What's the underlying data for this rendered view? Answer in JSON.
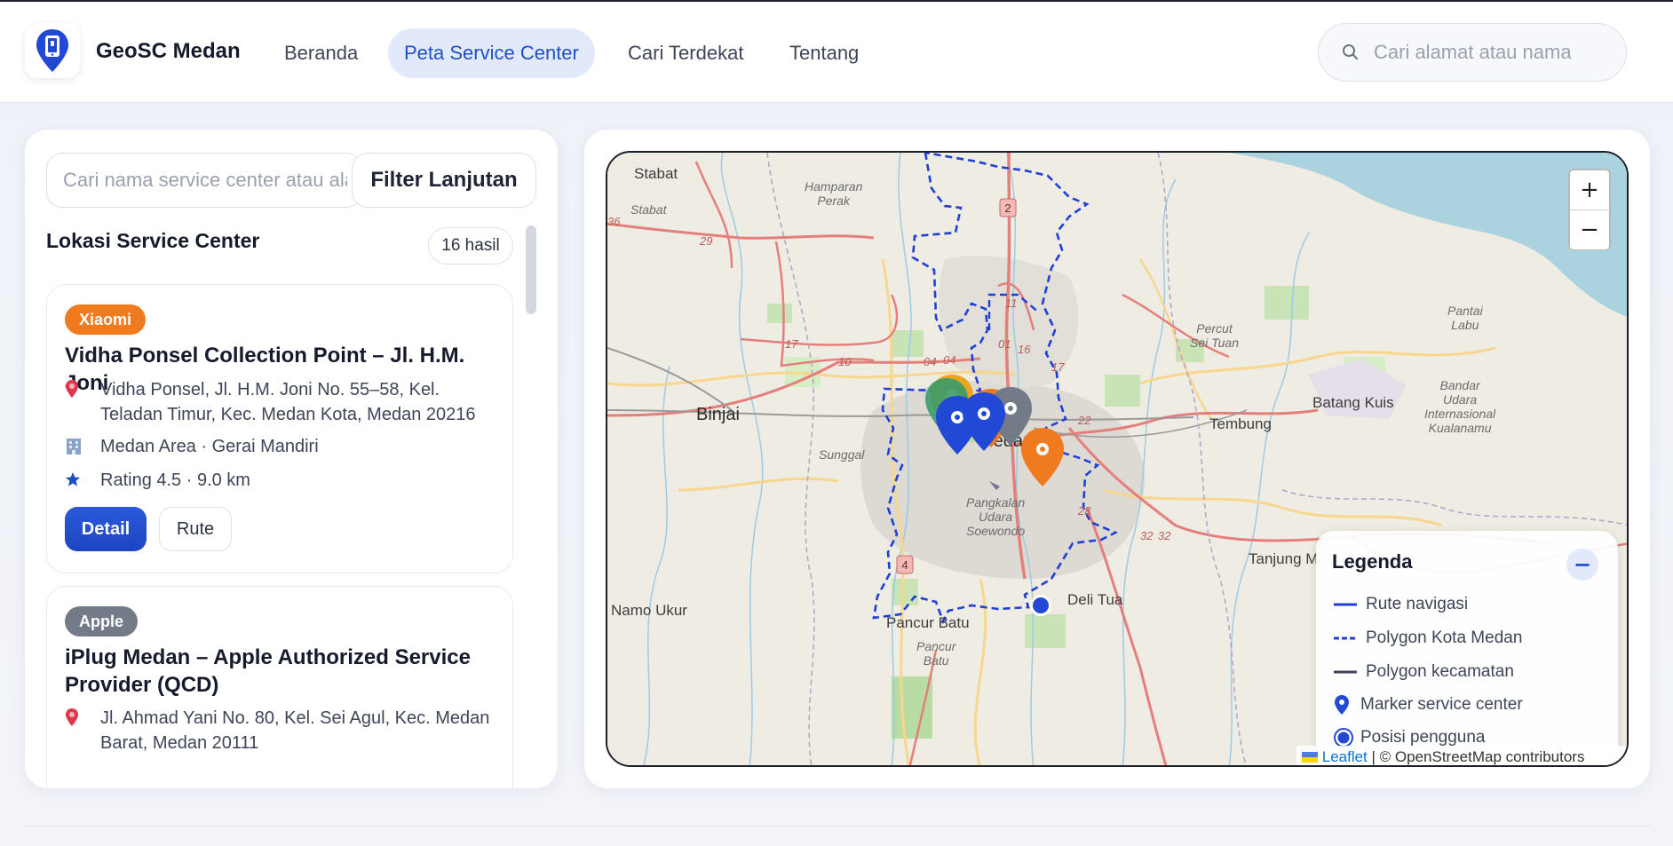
{
  "app": {
    "brand": "GeoSC Medan"
  },
  "nav": {
    "items": [
      {
        "label": "Beranda",
        "active": false
      },
      {
        "label": "Peta Service Center",
        "active": true
      },
      {
        "label": "Cari Terdekat",
        "active": false
      },
      {
        "label": "Tentang",
        "active": false
      }
    ],
    "search_placeholder": "Cari alamat atau nama"
  },
  "sidebar": {
    "search_placeholder": "Cari nama service center atau alamat",
    "filter_label": "Filter Lanjutan",
    "list_title": "Lokasi Service Center",
    "result_count": "16 hasil",
    "cards": [
      {
        "brand": "Xiaomi",
        "title": "Vidha Ponsel Collection Point – Jl. H.M. Joni",
        "address": "Vidha Ponsel, Jl. H.M. Joni No. 55–58, Kel. Teladan Timur, Kec. Medan Kota, Medan 20216",
        "area": "Medan Area · Gerai Mandiri",
        "rating": "Rating 4.5 · 9.0 km",
        "detail_label": "Detail",
        "route_label": "Rute"
      },
      {
        "brand": "Apple",
        "title": "iPlug Medan – Apple Authorized Service Provider (QCD)",
        "address": "Jl. Ahmad Yani No. 80, Kel. Sei Agul, Kec. Medan Barat, Medan 20111"
      }
    ]
  },
  "map": {
    "labels": {
      "stabat": "Stabat",
      "stabat_small": "Stabat",
      "hamparan": "Hamparan\nPerak",
      "binjai": "Binjai",
      "sunggal": "Sunggal",
      "medan": "Medan",
      "tembung": "Tembung",
      "batang_kuis": "Batang Kuis",
      "percut": "Percut\nSei Tuan",
      "pantai_labu": "Pantai\nLabu",
      "bandara": "Bandar\nUdara\nInternasional\nKualanamu",
      "pangkalan": "Pangkalan\nUdara\nSoewondo",
      "tanjung": "Tanjung M",
      "deli_tua": "Deli Tua",
      "namo_ukur": "Namo Ukur",
      "pancur_batu": "Pancur Batu",
      "pancur_batu_small": "Pancur\nBatu"
    },
    "road_numbers": [
      "36",
      "29",
      "17",
      "10",
      "04",
      "04",
      "01",
      "16",
      "17",
      "11",
      "2",
      "22",
      "28",
      "32",
      "32",
      "4"
    ],
    "zoom_in": "+",
    "zoom_out": "−",
    "legend": {
      "title": "Legenda",
      "toggle": "−",
      "items": [
        {
          "label": "Rute navigasi"
        },
        {
          "label": "Polygon Kota Medan"
        },
        {
          "label": "Polygon kecamatan"
        },
        {
          "label": "Marker service center"
        },
        {
          "label": "Posisi pengguna"
        }
      ]
    },
    "attribution": {
      "leaflet": "Leaflet",
      "osm": "| © OpenStreetMap contributors"
    },
    "colors": {
      "marker_blue": "#2249d6",
      "marker_orange": "#f07a1e",
      "marker_gray": "#737b89",
      "marker_yellow": "#e9a51c",
      "polygon_blue": "#1f3fd6",
      "sea": "#aad3df"
    }
  }
}
